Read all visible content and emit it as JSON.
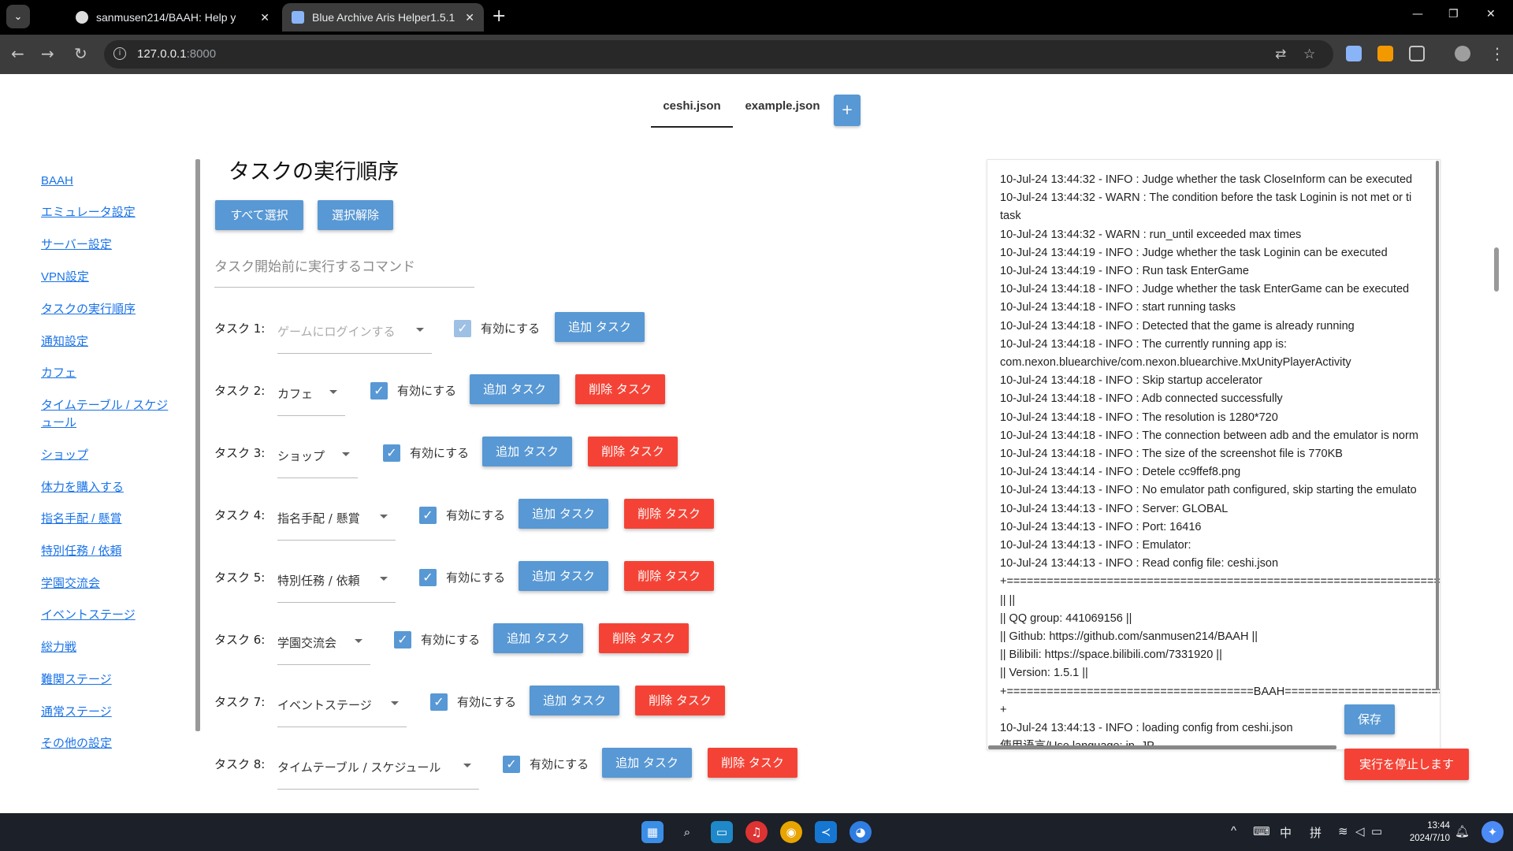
{
  "browser": {
    "tabs": [
      {
        "title": "sanmusen214/BAAH: Help y",
        "close": "✕"
      },
      {
        "title": "Blue Archive Aris Helper1.5.1",
        "close": "✕"
      }
    ],
    "new_tab": "+",
    "url_host": "127.0.0.1",
    "url_port": ":8000"
  },
  "config_tabs": [
    "ceshi.json",
    "example.json"
  ],
  "config_add": "+",
  "sidebar": {
    "items": [
      "BAAH",
      "エミュレータ設定",
      "サーバー設定",
      "VPN設定",
      "タスクの実行順序",
      "通知設定",
      "カフェ",
      "タイムテーブル / スケジ",
      "ュール",
      "ショップ",
      "体力を購入する",
      "指名手配 / 懸賞",
      "特別任務 / 依頼",
      "学園交流会",
      "イベントステージ",
      "総力戦",
      "難関ステージ",
      "通常ステージ",
      "その他の設定"
    ]
  },
  "main": {
    "title": "タスクの実行順序",
    "select_all": "すべて選択",
    "deselect": "選択解除",
    "cmd_placeholder": "タスク開始前に実行するコマンド",
    "enable_label": "有効にする",
    "add_label": "追加 タスク",
    "delete_label": "削除 タスク",
    "tasks": [
      {
        "label": "タスク 1:",
        "value": "ゲームにログインする",
        "check": "✓"
      },
      {
        "label": "タスク 2:",
        "value": "カフェ",
        "check": "✓"
      },
      {
        "label": "タスク 3:",
        "value": "ショップ",
        "check": "✓"
      },
      {
        "label": "タスク 4:",
        "value": "指名手配 / 懸賞",
        "check": "✓"
      },
      {
        "label": "タスク 5:",
        "value": "特別任務 / 依頼",
        "check": "✓"
      },
      {
        "label": "タスク 6:",
        "value": "学園交流会",
        "check": "✓"
      },
      {
        "label": "タスク 7:",
        "value": "イベントステージ",
        "check": "✓"
      },
      {
        "label": "タスク 8:",
        "value": "タイムテーブル / スケジュール",
        "check": "✓"
      }
    ]
  },
  "log": {
    "lines": [
      "10-Jul-24 13:44:32 - INFO : Judge whether the task CloseInform can be executed",
      "10-Jul-24 13:44:32 - WARN : The condition before the task Loginin is not met or ti",
      "task",
      "10-Jul-24 13:44:32 - WARN : run_until exceeded max times",
      "10-Jul-24 13:44:19 - INFO : Judge whether the task Loginin can be executed",
      "10-Jul-24 13:44:19 - INFO : Run task EnterGame",
      "10-Jul-24 13:44:18 - INFO : Judge whether the task EnterGame can be executed",
      "10-Jul-24 13:44:18 - INFO : start running tasks",
      "10-Jul-24 13:44:18 - INFO : Detected that the game is already running",
      "10-Jul-24 13:44:18 - INFO : The currently running app is:",
      "com.nexon.bluearchive/com.nexon.bluearchive.MxUnityPlayerActivity",
      "10-Jul-24 13:44:18 - INFO : Skip startup accelerator",
      "10-Jul-24 13:44:18 - INFO : Adb connected successfully",
      "10-Jul-24 13:44:18 - INFO : The resolution is 1280*720",
      "10-Jul-24 13:44:18 - INFO : The connection between adb and the emulator is norm",
      "10-Jul-24 13:44:18 - INFO : The size of the screenshot file is 770KB",
      "10-Jul-24 13:44:14 - INFO : Detele cc9ffef8.png",
      "10-Jul-24 13:44:13 - INFO : No emulator path configured, skip starting the emulato",
      "10-Jul-24 13:44:13 - INFO : Server: GLOBAL",
      "10-Jul-24 13:44:13 - INFO : Port: 16416",
      "10-Jul-24 13:44:13 - INFO : Emulator:",
      "10-Jul-24 13:44:13 - INFO : Read config file: ceshi.json",
      "+==================================================================",
      "|| ||",
      "|| QQ group: 441069156 ||",
      "|| Github: https://github.com/sanmusen214/BAAH ||",
      "|| Bilibili: https://space.bilibili.com/7331920 ||",
      "|| Version: 1.5.1 ||",
      "+=====================================BAAH==========================",
      "+",
      "10-Jul-24 13:44:13 - INFO : loading config from ceshi.json",
      "使用语言/Use language: jp_JP"
    ],
    "save": "保存",
    "stop": "実行を停止します"
  },
  "taskbar": {
    "tray": [
      "^",
      "中",
      "拼"
    ],
    "time": "13:44",
    "date": "2024/7/10"
  },
  "colors": {
    "primary": "#5898d4",
    "danger": "#f44336",
    "link": "#1a73e8"
  }
}
